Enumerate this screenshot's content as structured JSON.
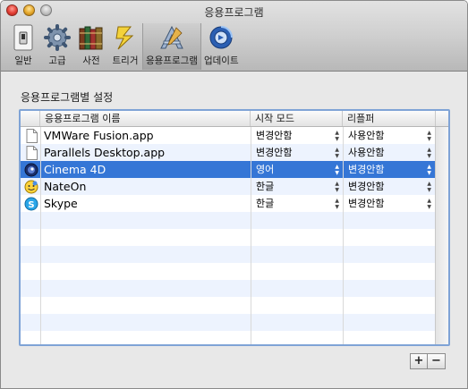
{
  "window": {
    "title": "응용프로그램"
  },
  "toolbar": {
    "items": [
      {
        "label": "일반",
        "icon": "switch-icon"
      },
      {
        "label": "고급",
        "icon": "gear-icon"
      },
      {
        "label": "사전",
        "icon": "books-icon"
      },
      {
        "label": "트리거",
        "icon": "lightning-icon"
      },
      {
        "label": "응용프로그램",
        "icon": "app-tools-icon",
        "selected": true
      },
      {
        "label": "업데이트",
        "icon": "update-globe-icon"
      }
    ]
  },
  "main": {
    "section_label": "응용프로그램별 설정",
    "table": {
      "headers": [
        "응용프로그램 이름",
        "시작 모드",
        "리플퍼"
      ],
      "rows": [
        {
          "icon": "document-icon",
          "name": "VMWare Fusion.app",
          "mode": "변경안함",
          "repl": "사용안함",
          "selected": false
        },
        {
          "icon": "document-icon",
          "name": "Parallels Desktop.app",
          "mode": "변경안함",
          "repl": "사용안함",
          "selected": false
        },
        {
          "icon": "cinema4d-icon",
          "name": "Cinema 4D",
          "mode": "영어",
          "repl": "변경안함",
          "selected": true
        },
        {
          "icon": "nateon-icon",
          "name": "NateOn",
          "mode": "한글",
          "repl": "변경안함",
          "selected": false
        },
        {
          "icon": "skype-icon",
          "name": "Skype",
          "mode": "한글",
          "repl": "변경안함",
          "selected": false
        }
      ]
    },
    "buttons": {
      "add": "+",
      "remove": "−"
    }
  },
  "colors": {
    "selection": "#3576d6",
    "alt_row": "#edf3fe",
    "focus_ring": "#7fa3d6"
  }
}
